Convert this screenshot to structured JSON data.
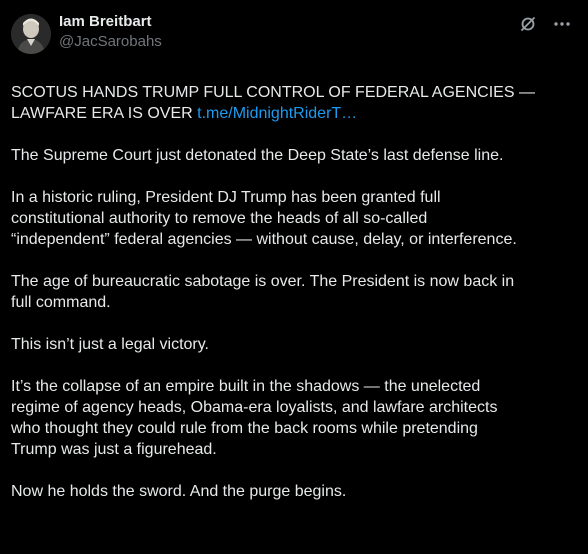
{
  "author": {
    "display_name": "Iam Breitbart",
    "handle": "@JacSarobahs"
  },
  "icons": {
    "grok": "grok-icon",
    "more": "more-icon"
  },
  "colors": {
    "background": "#000000",
    "text": "#e7e9ea",
    "secondary": "#71767b",
    "link": "#1d9bf0"
  },
  "post": {
    "headline": "SCOTUS HANDS TRUMP FULL CONTROL OF FEDERAL AGENCIES —\nLAWFARE ERA IS OVER ",
    "headline_link": "t.me/MidnightRiderT…",
    "paragraphs": [
      "The Supreme Court just detonated the Deep State’s last defense line.",
      "In a historic ruling, President DJ Trump has been granted full\nconstitutional authority to remove the heads of all so-called\n“independent” federal agencies — without cause, delay, or interference.",
      "The age of bureaucratic sabotage is over. The President is now back in\nfull command.",
      "This isn’t just a legal victory.",
      "It’s the collapse of an empire built in the shadows — the unelected\nregime of agency heads, Obama-era loyalists, and lawfare architects\nwho thought they could rule from the back rooms while pretending\nTrump was just a figurehead.",
      "Now he holds the sword. And the purge begins."
    ]
  }
}
